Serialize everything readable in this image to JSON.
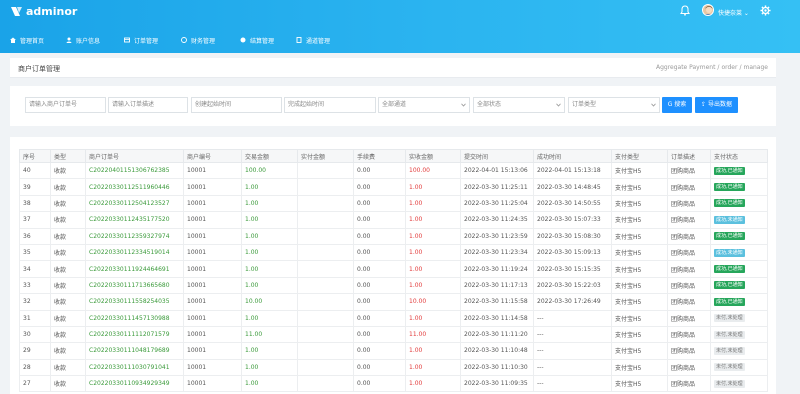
{
  "app": {
    "logo_text": "adminor"
  },
  "user": {
    "name": "快捷奈莱 ⌄"
  },
  "colors": {
    "topbar": "#1aa3e8",
    "primary": "#1e90ff",
    "success": "#26a65b",
    "danger": "#e23c3c"
  },
  "nav": [
    {
      "label": "管理首页",
      "icon": "home-icon"
    },
    {
      "label": "账户信息",
      "icon": "user-icon"
    },
    {
      "label": "订单管理",
      "icon": "order-icon"
    },
    {
      "label": "财务管理",
      "icon": "finance-icon"
    },
    {
      "label": "结算管理",
      "icon": "settle-icon"
    },
    {
      "label": "通道管理",
      "icon": "channel-icon"
    }
  ],
  "page": {
    "title": "商户订单管理",
    "breadcrumb": [
      "Aggregate Payment",
      "order",
      "manage"
    ]
  },
  "filters": {
    "order_no_placeholder": "请输入商户订单号",
    "desc_placeholder": "请输入订单描述",
    "start_placeholder": "创建起始时间",
    "end_placeholder": "完成起始时间",
    "channel_selected": "全部通道",
    "status_selected": "全部状态",
    "type_selected": "订单类型",
    "search_label": "G 搜索",
    "export_label": "⇪ 导出数据"
  },
  "table": {
    "headers": [
      "序号",
      "类型",
      "商户订单号",
      "商户编号",
      "交易金额",
      "实付金额",
      "手续费",
      "实收金额",
      "提交时间",
      "成功时间",
      "支付类型",
      "订单描述",
      "支付状态"
    ],
    "rows": [
      {
        "id": "40",
        "type": "收款",
        "order_no": "C20220401151306762385",
        "merchant": "10001",
        "amount": "100.00",
        "paid": "",
        "fee": "0.00",
        "received": "100.00",
        "submit": "2022-04-01 15:13:06",
        "success": "2022-04-01 15:13:18",
        "pay_type": "支付宝H5",
        "desc": "团购商品",
        "status": "成功,已通知",
        "status_kind": "ok"
      },
      {
        "id": "39",
        "type": "收款",
        "order_no": "C20220330112511960446",
        "merchant": "10001",
        "amount": "1.00",
        "paid": "",
        "fee": "0.00",
        "received": "1.00",
        "submit": "2022-03-30 11:25:11",
        "success": "2022-03-30 14:48:45",
        "pay_type": "支付宝H5",
        "desc": "团购商品",
        "status": "成功,已通知",
        "status_kind": "ok"
      },
      {
        "id": "38",
        "type": "收款",
        "order_no": "C20220330112504123527",
        "merchant": "10001",
        "amount": "1.00",
        "paid": "",
        "fee": "0.00",
        "received": "1.00",
        "submit": "2022-03-30 11:25:04",
        "success": "2022-03-30 14:50:55",
        "pay_type": "支付宝H5",
        "desc": "团购商品",
        "status": "成功,已通知",
        "status_kind": "ok"
      },
      {
        "id": "37",
        "type": "收款",
        "order_no": "C20220330112435177520",
        "merchant": "10001",
        "amount": "1.00",
        "paid": "",
        "fee": "0.00",
        "received": "1.00",
        "submit": "2022-03-30 11:24:35",
        "success": "2022-03-30 15:07:33",
        "pay_type": "支付宝H5",
        "desc": "团购商品",
        "status": "成功,未通知",
        "status_kind": "notify"
      },
      {
        "id": "36",
        "type": "收款",
        "order_no": "C20220330112359327974",
        "merchant": "10001",
        "amount": "1.00",
        "paid": "",
        "fee": "0.00",
        "received": "1.00",
        "submit": "2022-03-30 11:23:59",
        "success": "2022-03-30 15:08:30",
        "pay_type": "支付宝H5",
        "desc": "团购商品",
        "status": "成功,已通知",
        "status_kind": "ok"
      },
      {
        "id": "35",
        "type": "收款",
        "order_no": "C20220330112334519014",
        "merchant": "10001",
        "amount": "1.00",
        "paid": "",
        "fee": "0.00",
        "received": "1.00",
        "submit": "2022-03-30 11:23:34",
        "success": "2022-03-30 15:09:13",
        "pay_type": "支付宝H5",
        "desc": "团购商品",
        "status": "成功,未通知",
        "status_kind": "notify"
      },
      {
        "id": "34",
        "type": "收款",
        "order_no": "C20220330111924464691",
        "merchant": "10001",
        "amount": "1.00",
        "paid": "",
        "fee": "0.00",
        "received": "1.00",
        "submit": "2022-03-30 11:19:24",
        "success": "2022-03-30 15:15:35",
        "pay_type": "支付宝H5",
        "desc": "团购商品",
        "status": "成功,已通知",
        "status_kind": "ok"
      },
      {
        "id": "33",
        "type": "收款",
        "order_no": "C20220330111713665680",
        "merchant": "10001",
        "amount": "1.00",
        "paid": "",
        "fee": "0.00",
        "received": "1.00",
        "submit": "2022-03-30 11:17:13",
        "success": "2022-03-30 15:22:03",
        "pay_type": "支付宝H5",
        "desc": "团购商品",
        "status": "成功,已通知",
        "status_kind": "ok"
      },
      {
        "id": "32",
        "type": "收款",
        "order_no": "C20220330111558254035",
        "merchant": "10001",
        "amount": "10.00",
        "paid": "",
        "fee": "0.00",
        "received": "10.00",
        "submit": "2022-03-30 11:15:58",
        "success": "2022-03-30 17:26:49",
        "pay_type": "支付宝H5",
        "desc": "团购商品",
        "status": "成功,已通知",
        "status_kind": "ok"
      },
      {
        "id": "31",
        "type": "收款",
        "order_no": "C20220330111457130988",
        "merchant": "10001",
        "amount": "1.00",
        "paid": "",
        "fee": "0.00",
        "received": "1.00",
        "submit": "2022-03-30 11:14:58",
        "success": "---",
        "pay_type": "支付宝H5",
        "desc": "团购商品",
        "status": "未付,未处理",
        "status_kind": "unpaid"
      },
      {
        "id": "30",
        "type": "收款",
        "order_no": "C20220330111112071579",
        "merchant": "10001",
        "amount": "11.00",
        "paid": "",
        "fee": "0.00",
        "received": "11.00",
        "submit": "2022-03-30 11:11:20",
        "success": "---",
        "pay_type": "支付宝H5",
        "desc": "团购商品",
        "status": "未付,未处理",
        "status_kind": "unpaid"
      },
      {
        "id": "29",
        "type": "收款",
        "order_no": "C20220330111048179689",
        "merchant": "10001",
        "amount": "1.00",
        "paid": "",
        "fee": "0.00",
        "received": "1.00",
        "submit": "2022-03-30 11:10:48",
        "success": "---",
        "pay_type": "支付宝H5",
        "desc": "团购商品",
        "status": "未付,未处理",
        "status_kind": "unpaid"
      },
      {
        "id": "28",
        "type": "收款",
        "order_no": "C20220330111030791041",
        "merchant": "10001",
        "amount": "1.00",
        "paid": "",
        "fee": "0.00",
        "received": "1.00",
        "submit": "2022-03-30 11:10:30",
        "success": "---",
        "pay_type": "支付宝H5",
        "desc": "团购商品",
        "status": "未付,未处理",
        "status_kind": "unpaid"
      },
      {
        "id": "27",
        "type": "收款",
        "order_no": "C20220330110934929349",
        "merchant": "10001",
        "amount": "1.00",
        "paid": "",
        "fee": "0.00",
        "received": "1.00",
        "submit": "2022-03-30 11:09:35",
        "success": "---",
        "pay_type": "支付宝H5",
        "desc": "团购商品",
        "status": "未付,未处理",
        "status_kind": "unpaid"
      }
    ]
  }
}
